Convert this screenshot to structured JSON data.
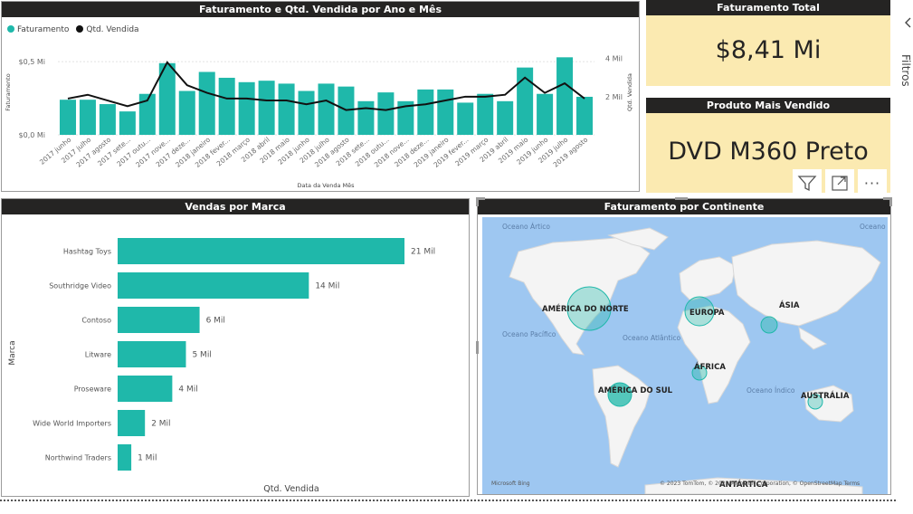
{
  "colors": {
    "teal": "#1fb8aa",
    "header": "#252423",
    "card_bg": "#fbeab1",
    "map_water": "#9ec7f1",
    "map_land": "#f4f4f4"
  },
  "combo": {
    "title": "Faturamento e Qtd. Vendida por Ano e Mês",
    "legend": {
      "faturamento": "Faturamento",
      "qtd": "Qtd. Vendida"
    },
    "xlabel": "Data da Venda Mês",
    "ylabel_left": "Faturamento",
    "ylabel_right": "Qtd. Vendida"
  },
  "card1": {
    "title": "Faturamento Total",
    "value": "$8,41 Mi"
  },
  "card2": {
    "title": "Produto Mais Vendido",
    "value": "DVD M360 Preto"
  },
  "toolbar": {
    "filter_icon": "filter-icon",
    "focus_icon": "focus-mode-icon",
    "more_icon": "more-options-icon",
    "more_label": "···"
  },
  "bars": {
    "title": "Vendas por Marca",
    "ylabel": "Marca",
    "xlabel": "Qtd. Vendida"
  },
  "map": {
    "title": "Faturamento por Continente",
    "oceans": [
      "Oceano Ártico",
      "Oceano Pacífico",
      "Oceano Atlântico",
      "Oceano Índico",
      "Oceano Ártico"
    ],
    "continents": [
      "AMÉRICA DO NORTE",
      "EUROPA",
      "ÁSIA",
      "ÁFRICA",
      "AMÉRICA DO SUL",
      "AUSTRÁLIA",
      "ANTÁRTICA"
    ],
    "attribution_left": "Microsoft Bing",
    "attribution_right": "© 2023 TomTom, © 2023 Microsoft Corporation, © OpenStreetMap  Terms"
  },
  "rightpane": {
    "text": "Filtros"
  },
  "chart_data": [
    {
      "type": "bar",
      "title": "Faturamento e Qtd. Vendida por Ano e Mês",
      "xlabel": "Data da Venda Mês",
      "ylabel": "Faturamento",
      "y2label": "Qtd. Vendida",
      "categories": [
        "2017 junho",
        "2017 julho",
        "2017 agosto",
        "2017 sete...",
        "2017 outu...",
        "2017 nove...",
        "2017 deze...",
        "2018 janeiro",
        "2018 fever...",
        "2018 março",
        "2018 abril",
        "2018 maio",
        "2018 junho",
        "2018 julho",
        "2018 agosto",
        "2018 sete...",
        "2018 outu...",
        "2018 nove...",
        "2018 deze...",
        "2019 janeiro",
        "2019 fever...",
        "2019 março",
        "2019 abril",
        "2019 maio",
        "2019 junho",
        "2019 julho",
        "2019 agosto"
      ],
      "y_ticks": [
        "$0,0 Mi",
        "$0,5 Mi"
      ],
      "y2_ticks": [
        "2 Mil",
        "4 Mil"
      ],
      "ylim": [
        0,
        0.6
      ],
      "y2lim": [
        0,
        4.6
      ],
      "series": [
        {
          "name": "Faturamento",
          "type": "bar",
          "values": [
            0.24,
            0.24,
            0.21,
            0.16,
            0.28,
            0.49,
            0.3,
            0.43,
            0.39,
            0.36,
            0.37,
            0.35,
            0.3,
            0.35,
            0.33,
            0.23,
            0.29,
            0.23,
            0.31,
            0.31,
            0.22,
            0.28,
            0.23,
            0.46,
            0.28,
            0.53,
            0.26
          ]
        },
        {
          "name": "Qtd. Vendida",
          "type": "line",
          "values": [
            1.9,
            2.1,
            1.8,
            1.5,
            1.8,
            3.8,
            2.6,
            2.2,
            1.9,
            1.9,
            1.8,
            1.8,
            1.6,
            1.8,
            1.3,
            1.4,
            1.3,
            1.5,
            1.6,
            1.8,
            2.0,
            2.0,
            2.1,
            3.0,
            2.2,
            2.7,
            1.9
          ]
        }
      ]
    },
    {
      "type": "bar",
      "orientation": "horizontal",
      "title": "Vendas por Marca",
      "xlabel": "Qtd. Vendida",
      "ylabel": "Marca",
      "categories": [
        "Hashtag Toys",
        "Southridge Video",
        "Contoso",
        "Litware",
        "Proseware",
        "Wide World Importers",
        "Northwind Traders"
      ],
      "values": [
        21,
        14,
        6,
        5,
        4,
        2,
        1
      ],
      "data_labels": [
        "21 Mil",
        "14 Mil",
        "6 Mil",
        "5 Mil",
        "4 Mil",
        "2 Mil",
        "1 Mil"
      ]
    }
  ]
}
